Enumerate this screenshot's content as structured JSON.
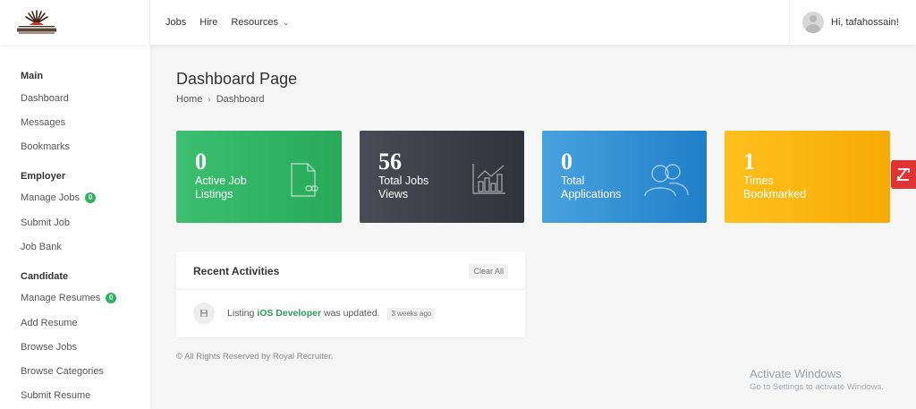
{
  "logo": {
    "text": "Royal Recruiter",
    "color": "#4a2c1a"
  },
  "nav": {
    "jobs": "Jobs",
    "hire": "Hire",
    "resources": "Resources"
  },
  "user": {
    "greeting": "Hi, tafahossain!"
  },
  "sidebar": {
    "main": {
      "title": "Main",
      "items": [
        "Dashboard",
        "Messages",
        "Bookmarks"
      ]
    },
    "employer": {
      "title": "Employer",
      "items": [
        {
          "label": "Manage Jobs",
          "badge": "0"
        },
        {
          "label": "Submit Job"
        },
        {
          "label": "Job Bank"
        }
      ]
    },
    "candidate": {
      "title": "Candidate",
      "items": [
        {
          "label": "Manage Resumes",
          "badge": "0"
        },
        {
          "label": "Add Resume"
        },
        {
          "label": "Browse Jobs"
        },
        {
          "label": "Browse Categories"
        },
        {
          "label": "Submit Resume"
        }
      ]
    }
  },
  "page": {
    "title": "Dashboard Page",
    "breadcrumb": {
      "home": "Home",
      "current": "Dashboard"
    }
  },
  "stats": [
    {
      "value": "0",
      "label": "Active Job Listings",
      "color": "#2db35e",
      "icon": "file-link-icon"
    },
    {
      "value": "56",
      "label": "Total Jobs Views",
      "color": "#3a3b44",
      "icon": "bar-chart-icon"
    },
    {
      "value": "0",
      "label": "Total Applications",
      "color": "#2f8ed6",
      "icon": "users-icon"
    },
    {
      "value": "1",
      "label": "Times Bookmarked",
      "color": "#fbb40f",
      "icon": "bookmark-icon"
    }
  ],
  "activities": {
    "title": "Recent Activities",
    "clear_label": "Clear All",
    "items": [
      {
        "prefix": "Listing",
        "link": "iOS Developer",
        "suffix": "was updated.",
        "time": "3 weeks ago",
        "icon": "save-icon"
      }
    ]
  },
  "footer": {
    "text": "© All Rights Reserved by Royal Recruiter."
  },
  "windows": {
    "title": "Activate Windows",
    "subtitle": "Go to Settings to activate Windows."
  },
  "floating": {
    "icon": "expand-icon",
    "color": "#e03434"
  }
}
